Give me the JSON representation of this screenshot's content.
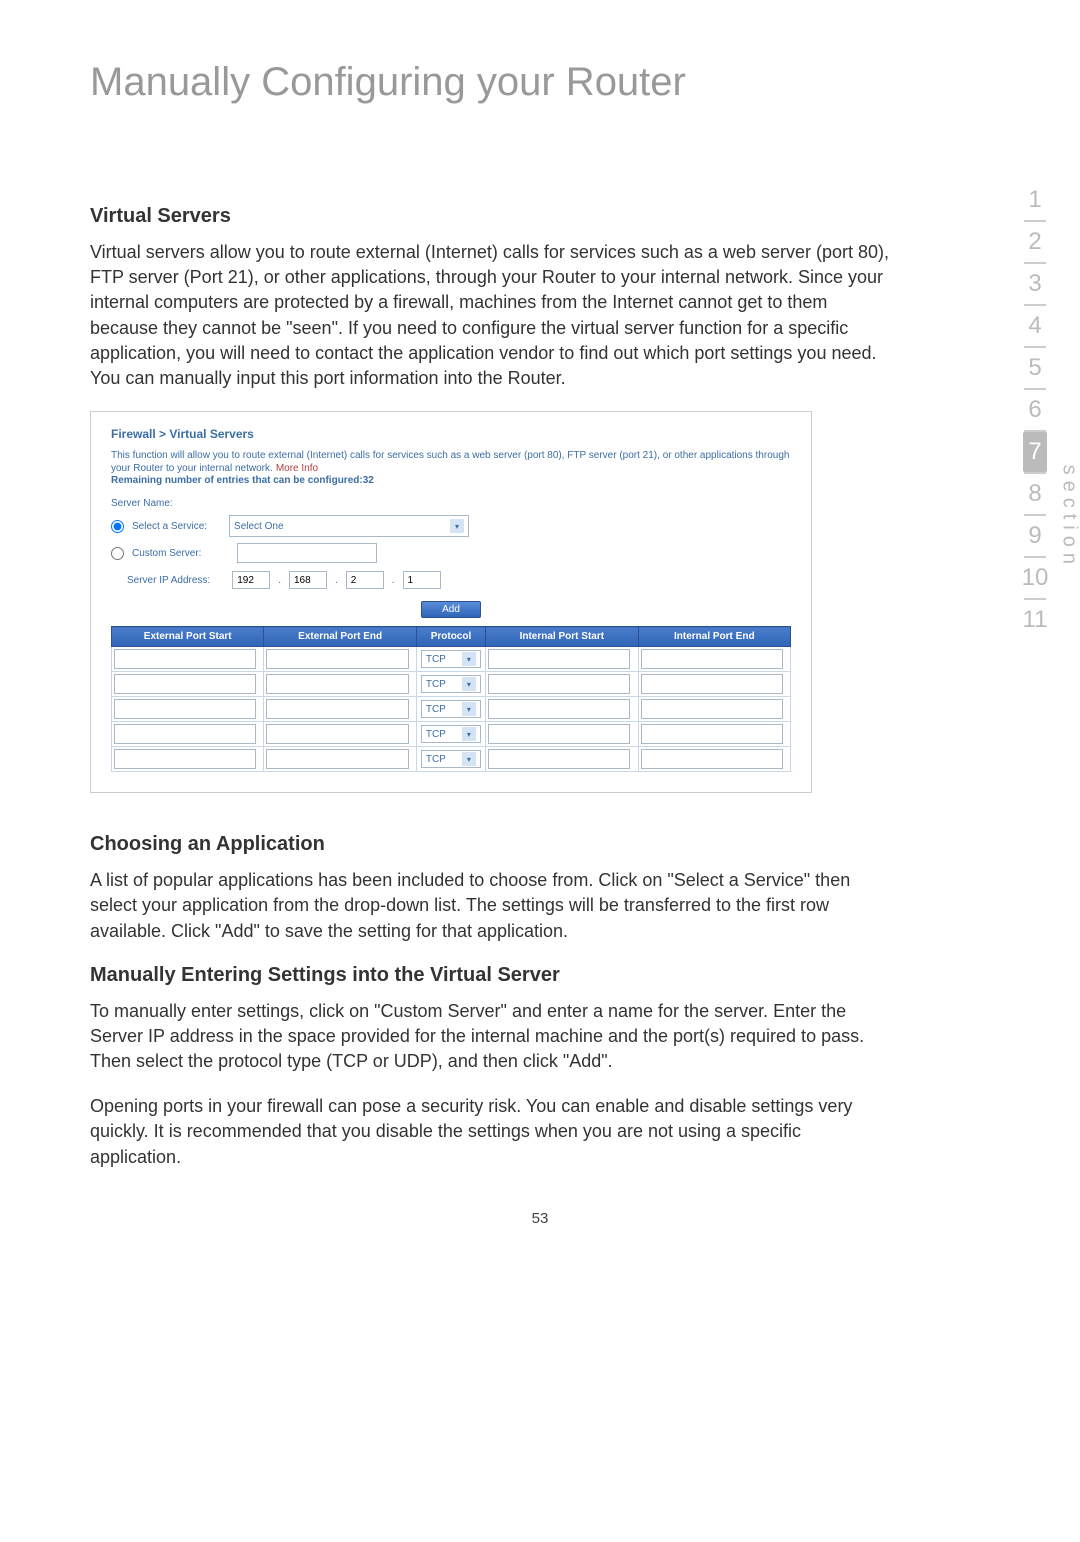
{
  "page_title": "Manually Configuring your Router",
  "nav": {
    "items": [
      "1",
      "2",
      "3",
      "4",
      "5",
      "6",
      "7",
      "8",
      "9",
      "10",
      "11"
    ],
    "active_index": 6,
    "label": "section"
  },
  "sections": {
    "virtual_servers": {
      "heading": "Virtual Servers",
      "body": "Virtual servers allow you to route external (Internet) calls for services such as a web server (port 80), FTP server (Port 21), or other applications, through your Router to your internal network. Since your internal computers are protected by a firewall, machines from the Internet cannot get to them because they cannot be \"seen\". If you need to configure the virtual server function for a specific application, you will need to contact the application vendor to find out which port settings you need. You can manually input this port information into the Router."
    },
    "choosing": {
      "heading": "Choosing an Application",
      "body": "A list of popular applications has been included to choose from. Click on \"Select a Service\" then select your application from the drop-down list. The settings will be transferred to the first row available. Click \"Add\" to save the setting for that application."
    },
    "manual_entry": {
      "heading": "Manually Entering Settings into the Virtual Server",
      "body1": "To manually enter settings, click on \"Custom Server\" and enter a name for the server. Enter the Server IP address in the space provided for the internal machine and the port(s) required to pass. Then select the protocol type (TCP or UDP), and then click \"Add\".",
      "body2": "Opening ports in your firewall can pose a security risk. You can enable and disable settings very quickly. It is recommended that you disable the settings when you are not using a specific application."
    }
  },
  "screenshot": {
    "breadcrumb": "Firewall > Virtual Servers",
    "desc": "This function will allow you to route external (Internet) calls for services such as a web server (port 80), FTP server (port 21), or other applications through your Router to your internal network.",
    "more_info": "More Info",
    "remaining": "Remaining number of entries that can be configured:32",
    "server_name_label": "Server Name:",
    "select_service_label": "Select a Service:",
    "select_service_value": "Select One",
    "custom_server_label": "Custom Server:",
    "server_ip_label": "Server IP Address:",
    "server_ip": [
      "192",
      "168",
      "2",
      "1"
    ],
    "add_button": "Add",
    "table": {
      "headers": [
        "External Port Start",
        "External Port End",
        "Protocol",
        "Internal Port Start",
        "Internal Port End"
      ],
      "protocol_value": "TCP",
      "row_count": 5
    }
  },
  "page_number": "53"
}
